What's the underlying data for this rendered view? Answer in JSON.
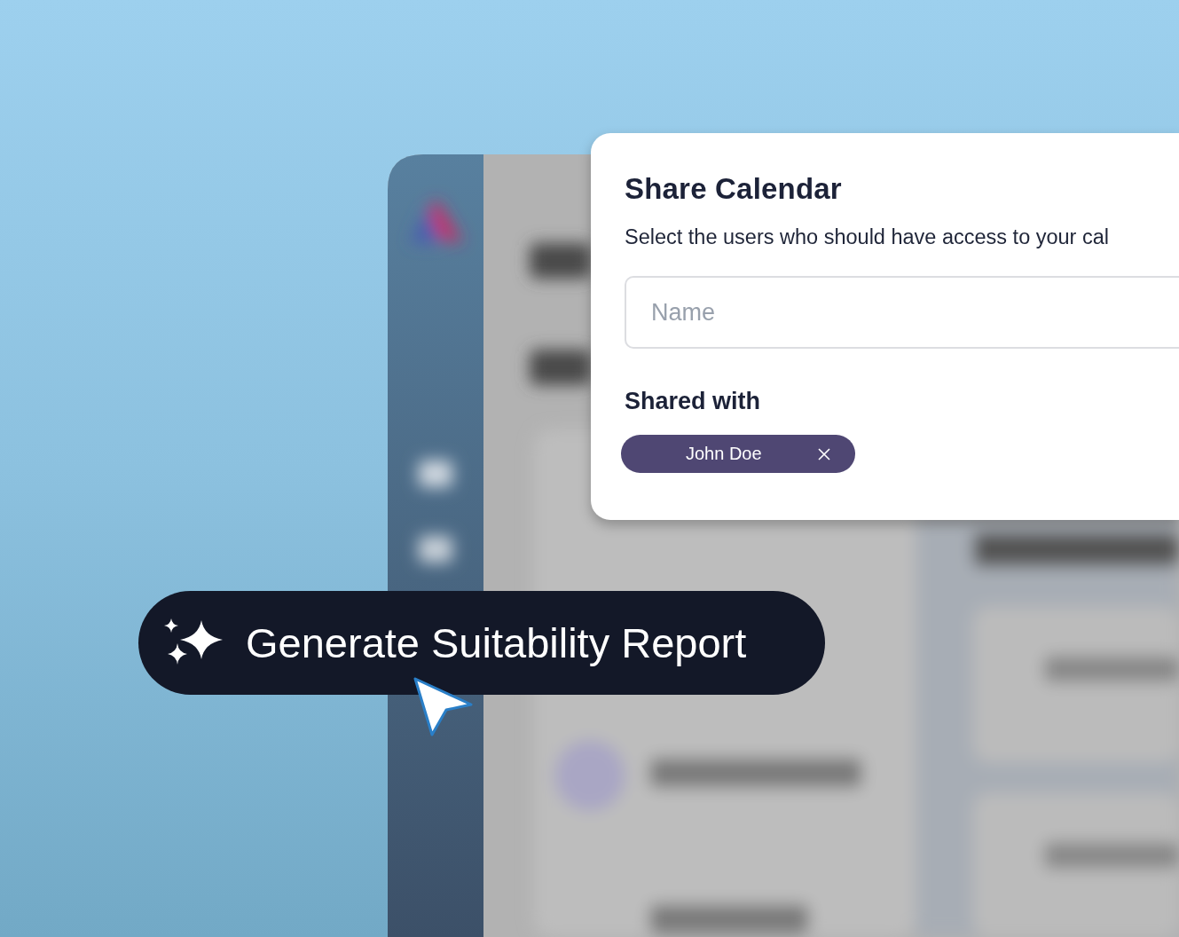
{
  "dialog": {
    "title": "Share Calendar",
    "description": "Select the users who should have access to your cal",
    "name_field": {
      "placeholder": "Name"
    },
    "shared_with": {
      "heading": "Shared with",
      "users": [
        {
          "name": "John Doe"
        }
      ]
    }
  },
  "action_button": {
    "label": "Generate Suitability Report"
  }
}
